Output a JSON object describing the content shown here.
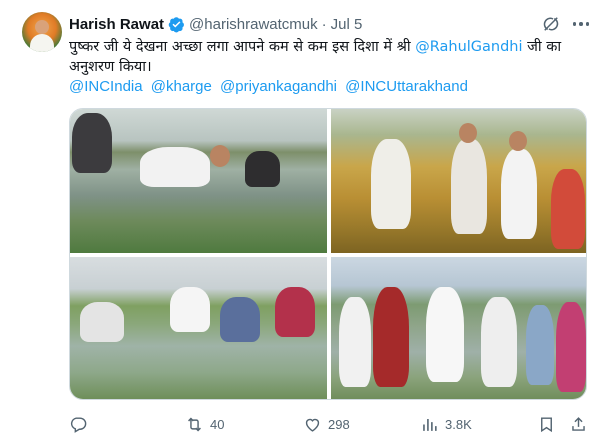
{
  "author": {
    "name": "Harish Rawat",
    "handle": "@harishrawatcmuk",
    "separator": "·",
    "date": "Jul 5"
  },
  "tweet": {
    "text_part1": "पुष्कर जी ये देखना अच्छा लगा आपने कम से कम इस दिशा में श्री ",
    "mention_inline": "@RahulGandhi",
    "text_part2": " जी का अनुशरण किया।",
    "tags": [
      "@INCIndia",
      "@kharge",
      "@priyankagandhi",
      "@INCUttarakhand"
    ]
  },
  "actions": {
    "replies": "",
    "retweets": "40",
    "likes": "298",
    "views": "3.8K"
  },
  "colors": {
    "link": "#1d9bf0",
    "secondary_text": "#536471",
    "verified": "#1d9bf0"
  },
  "icons": [
    "verified-badge-icon",
    "grok-icon",
    "more-icon",
    "reply-icon",
    "retweet-icon",
    "like-icon",
    "views-icon",
    "bookmark-icon",
    "share-icon"
  ]
}
